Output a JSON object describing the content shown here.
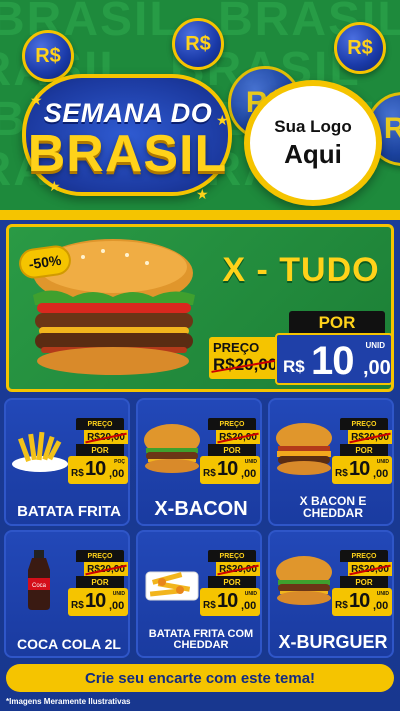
{
  "header": {
    "bg_word": "BRASIL",
    "title_line1": "SEMANA DO",
    "title_line2": "BRASIL",
    "coin_symbol": "R$",
    "logo_line1": "Sua Logo",
    "logo_line2": "Aqui"
  },
  "hero": {
    "discount": "-50%",
    "name": "X - TUDO",
    "preco_label": "PREÇO",
    "old_price": "R$20,00",
    "por_label": "POR",
    "currency": "R$",
    "price_int": "10",
    "price_cents": ",00",
    "unit": "UNID"
  },
  "products": [
    {
      "name": "BATATA FRITA",
      "preco_label": "PREÇO",
      "old_price": "R$20,00",
      "por_label": "POR",
      "currency": "R$",
      "price_int": "10",
      "price_cents": ",00",
      "unit": "POÇ",
      "image": "fries-icon"
    },
    {
      "name": "X-BACON",
      "preco_label": "PREÇO",
      "old_price": "R$20,00",
      "por_label": "POR",
      "currency": "R$",
      "price_int": "10",
      "price_cents": ",00",
      "unit": "UNID",
      "image": "burger-icon"
    },
    {
      "name": "X BACON E CHEDDAR",
      "preco_label": "PREÇO",
      "old_price": "R$20,00",
      "por_label": "POR",
      "currency": "R$",
      "price_int": "10",
      "price_cents": ",00",
      "unit": "UNID",
      "image": "burger-cheddar-icon"
    },
    {
      "name": "COCA COLA 2L",
      "preco_label": "PREÇO",
      "old_price": "R$20,00",
      "por_label": "POR",
      "currency": "R$",
      "price_int": "10",
      "price_cents": ",00",
      "unit": "UNID",
      "image": "soda-bottle-icon"
    },
    {
      "name": "BATATA FRITA COM CHEDDAR",
      "preco_label": "PREÇO",
      "old_price": "R$20,00",
      "por_label": "POR",
      "currency": "R$",
      "price_int": "10",
      "price_cents": ",00",
      "unit": "UNID",
      "image": "fries-cheddar-icon"
    },
    {
      "name": "X-BURGUER",
      "preco_label": "PREÇO",
      "old_price": "R$20,00",
      "por_label": "POR",
      "currency": "R$",
      "price_int": "10",
      "price_cents": ",00",
      "unit": "UNID",
      "image": "burger-icon"
    }
  ],
  "footer": {
    "cta": "Crie seu encarte com este tema!",
    "disclaimer": "*Imagens Meramente Ilustrativas"
  },
  "colors": {
    "green": "#1e8a3c",
    "blue": "#1b3c98",
    "yellow": "#f5c400"
  }
}
